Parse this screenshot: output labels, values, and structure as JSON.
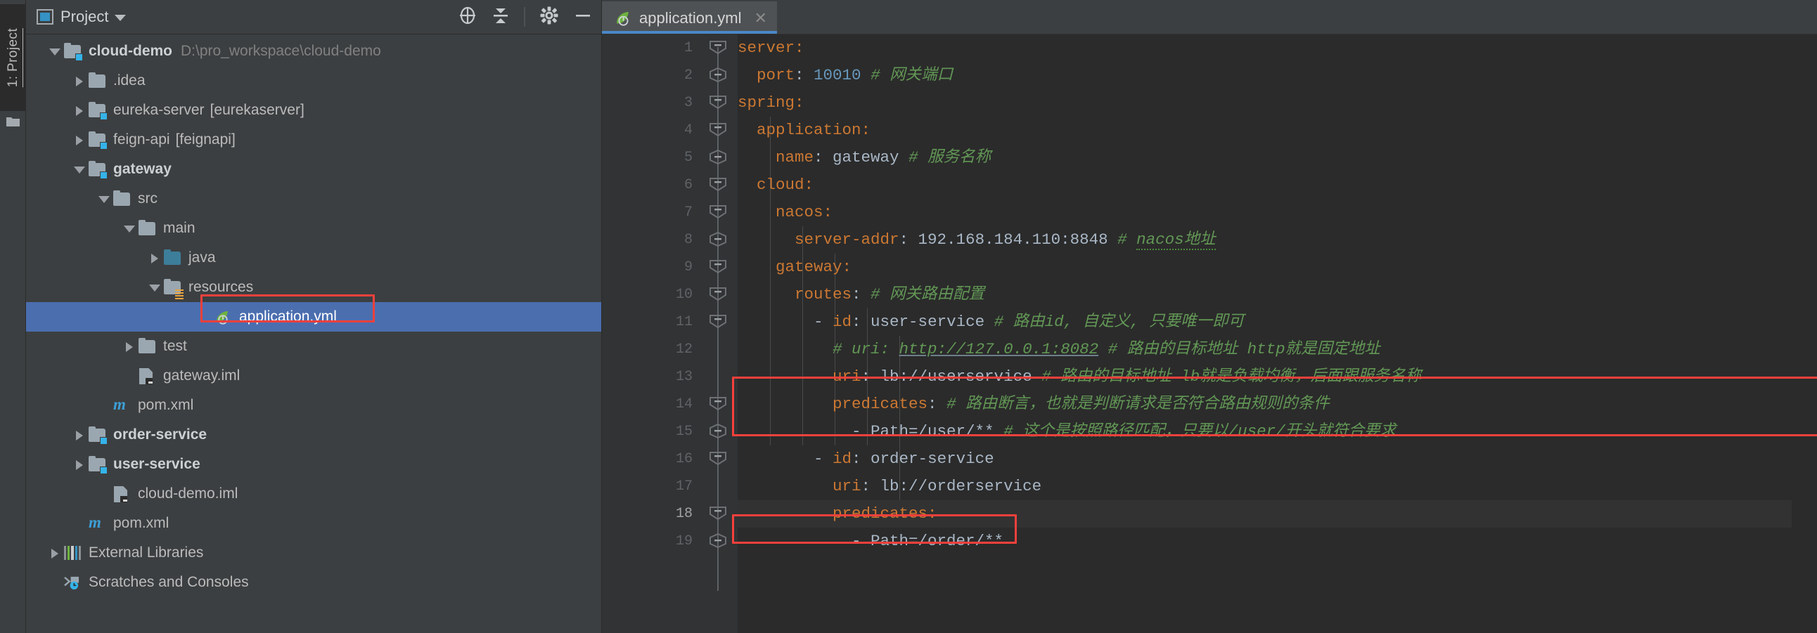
{
  "window": {
    "left_strip_tab": "1: Project",
    "left_strip_icon": "project-folder-icon"
  },
  "panel": {
    "title": "Project",
    "title_icon": "project-view-icon",
    "caret_icon": "chevron-down-icon",
    "actions": [
      {
        "name": "locate-icon",
        "label": "Select Opened File"
      },
      {
        "name": "collapse-all-icon",
        "label": "Collapse All"
      },
      {
        "name": "gear-icon",
        "label": "Settings"
      },
      {
        "name": "minimize-icon",
        "label": "Hide"
      }
    ]
  },
  "tree": {
    "items": [
      {
        "label": "cloud-demo",
        "path": "D:\\pro_workspace\\cloud-demo",
        "icon": "module-folder-icon",
        "arrow": "down",
        "indent": 0,
        "bold": true,
        "selected": false
      },
      {
        "label": ".idea",
        "path": "",
        "icon": "folder-icon",
        "arrow": "right",
        "indent": 1,
        "bold": false,
        "selected": false
      },
      {
        "label": "eureka-server",
        "suffix": "[eurekaserver]",
        "path": "",
        "icon": "module-folder-icon",
        "arrow": "right",
        "indent": 1,
        "bold": false,
        "selected": false
      },
      {
        "label": "feign-api",
        "suffix": "[feignapi]",
        "path": "",
        "icon": "module-folder-icon",
        "arrow": "right",
        "indent": 1,
        "bold": false,
        "selected": false
      },
      {
        "label": "gateway",
        "path": "",
        "icon": "module-folder-icon",
        "arrow": "down",
        "indent": 1,
        "bold": true,
        "selected": false
      },
      {
        "label": "src",
        "path": "",
        "icon": "folder-icon",
        "arrow": "down",
        "indent": 2,
        "bold": false,
        "selected": false
      },
      {
        "label": "main",
        "path": "",
        "icon": "folder-icon",
        "arrow": "down",
        "indent": 3,
        "bold": false,
        "selected": false
      },
      {
        "label": "java",
        "path": "",
        "icon": "source-root-folder-icon",
        "arrow": "right",
        "indent": 4,
        "bold": false,
        "selected": false
      },
      {
        "label": "resources",
        "path": "",
        "icon": "resource-root-folder-icon",
        "arrow": "down",
        "indent": 4,
        "bold": false,
        "selected": false
      },
      {
        "label": "application.yml",
        "path": "",
        "icon": "spring-yaml-file-icon",
        "arrow": "none",
        "indent": 5,
        "bold": false,
        "selected": true
      },
      {
        "label": "test",
        "path": "",
        "icon": "folder-icon",
        "arrow": "right",
        "indent": 3,
        "bold": false,
        "selected": false
      },
      {
        "label": "gateway.iml",
        "path": "",
        "icon": "iml-file-icon",
        "arrow": "none",
        "indent": 3,
        "bold": false,
        "selected": false
      },
      {
        "label": "pom.xml",
        "path": "",
        "icon": "maven-file-icon",
        "arrow": "none",
        "indent": 2,
        "bold": false,
        "selected": false
      },
      {
        "label": "order-service",
        "path": "",
        "icon": "module-folder-icon",
        "arrow": "right",
        "indent": 1,
        "bold": true,
        "selected": false
      },
      {
        "label": "user-service",
        "path": "",
        "icon": "module-folder-icon",
        "arrow": "right",
        "indent": 1,
        "bold": true,
        "selected": false
      },
      {
        "label": "cloud-demo.iml",
        "path": "",
        "icon": "iml-file-icon",
        "arrow": "none",
        "indent": 2,
        "bold": false,
        "selected": false
      },
      {
        "label": "pom.xml",
        "path": "",
        "icon": "maven-file-icon",
        "arrow": "none",
        "indent": 1,
        "bold": false,
        "selected": false
      },
      {
        "label": "External Libraries",
        "path": "",
        "icon": "libraries-icon",
        "arrow": "right",
        "indent": 0,
        "bold": false,
        "selected": false
      },
      {
        "label": "Scratches and Consoles",
        "path": "",
        "icon": "scratches-icon",
        "arrow": "none",
        "indent": 0,
        "bold": false,
        "selected": false
      }
    ]
  },
  "editor": {
    "tab": {
      "label": "application.yml",
      "icon": "spring-yaml-file-icon",
      "close_icon": "close-icon"
    },
    "current_line": 18,
    "line_numbers": [
      "1",
      "2",
      "3",
      "4",
      "5",
      "6",
      "7",
      "8",
      "9",
      "10",
      "11",
      "12",
      "13",
      "14",
      "15",
      "16",
      "17",
      "18",
      "19"
    ],
    "lines": [
      {
        "n": 1,
        "text": "server:"
      },
      {
        "n": 2,
        "text": "  port: 10010 # 网关端口"
      },
      {
        "n": 3,
        "text": "spring:"
      },
      {
        "n": 4,
        "text": "  application:"
      },
      {
        "n": 5,
        "text": "    name: gateway # 服务名称"
      },
      {
        "n": 6,
        "text": "  cloud:"
      },
      {
        "n": 7,
        "text": "    nacos:"
      },
      {
        "n": 8,
        "text": "      server-addr: 192.168.184.110:8848 # nacos地址"
      },
      {
        "n": 9,
        "text": "    gateway:"
      },
      {
        "n": 10,
        "text": "      routes: # 网关路由配置"
      },
      {
        "n": 11,
        "text": "        - id: user-service # 路由id, 自定义, 只要唯一即可"
      },
      {
        "n": 12,
        "text": "          # uri: http://127.0.0.1:8082 # 路由的目标地址 http就是固定地址"
      },
      {
        "n": 13,
        "text": "          uri: lb://userservice # 路由的目标地址 lb就是负载均衡，后面跟服务名称"
      },
      {
        "n": 14,
        "text": "          predicates: # 路由断言，也就是判断请求是否符合路由规则的条件"
      },
      {
        "n": 15,
        "text": "            - Path=/user/** # 这个是按照路径匹配，只要以/user/开头就符合要求"
      },
      {
        "n": 16,
        "text": "        - id: order-service"
      },
      {
        "n": 17,
        "text": "          uri: lb://orderservice"
      },
      {
        "n": 18,
        "text": "          predicates:"
      },
      {
        "n": 19,
        "text": "            - Path=/order/**"
      }
    ]
  },
  "annotations": {
    "color": "#f5403c",
    "boxes": [
      {
        "name": "annotation-box-application-yml",
        "target": "application.yml tree node"
      },
      {
        "name": "annotation-box-user-service-uri",
        "target": "lines 12-13 uri"
      },
      {
        "name": "annotation-box-order-service-uri",
        "target": "line 17 uri"
      }
    ]
  },
  "colors": {
    "panel_bg": "#3c3f41",
    "editor_bg": "#2b2b2b",
    "gutter_bg": "#313335",
    "selection_blue": "#4b6eaf",
    "tab_underline": "#4a88c7",
    "key_orange": "#cc7832",
    "number_blue": "#6897bb",
    "comment_green": "#629755",
    "text_grey": "#a9b7c6",
    "annotation_red": "#f5403c"
  }
}
